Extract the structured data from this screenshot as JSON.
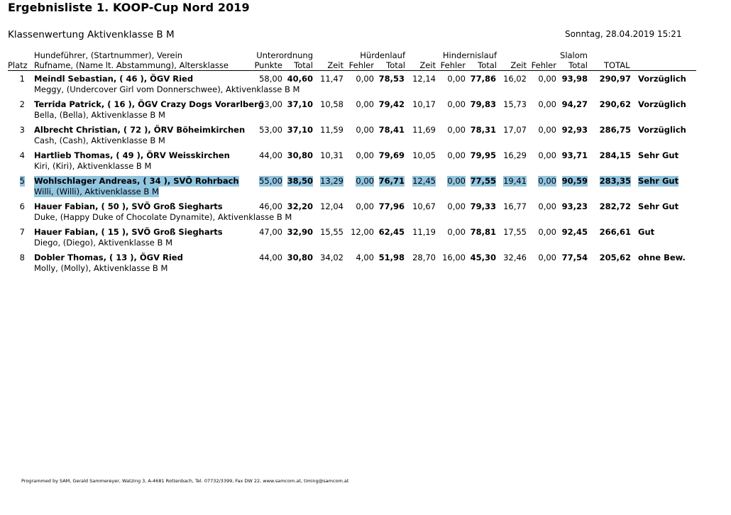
{
  "title": "Ergebnisliste 1. KOOP-Cup Nord 2019",
  "subtitle": "Klassenwertung Aktivenklasse B M",
  "datetime": "Sonntag, 28.04.2019 15:21",
  "headers": {
    "col_info_1": "Hundeführer, (Startnummer), Verein",
    "col_info_2": "Rufname, (Name lt. Abstammung), Altersklasse",
    "platz": "Platz",
    "unterordnung": "Unterordnung",
    "huerdenlauf": "Hürdenlauf",
    "hindernislauf": "Hindernislauf",
    "slalom": "Slalom",
    "punkte": "Punkte",
    "total": "Total",
    "zeit": "Zeit",
    "fehler": "Fehler",
    "grand_total": "TOTAL"
  },
  "rows": [
    {
      "platz": "1",
      "handler": "Meindl Sebastian, ( 46 ), ÖGV Ried",
      "dog": "Meggy, (Undercover Girl vom Donnerschwee), Aktivenklasse B M",
      "uo_punkte": "58,00",
      "uo_total": "40,60",
      "h_zeit": "11,47",
      "h_fehler": "0,00",
      "h_total": "78,53",
      "hi_zeit": "12,14",
      "hi_fehler": "0,00",
      "hi_total": "77,86",
      "s_zeit": "16,02",
      "s_fehler": "0,00",
      "s_total": "93,98",
      "total": "290,97",
      "grade": "Vorzüglich"
    },
    {
      "platz": "2",
      "handler": "Terrida Patrick, ( 16 ), ÖGV Crazy Dogs Vorarlberg",
      "dog": "Bella, (Bella), Aktivenklasse B M",
      "uo_punkte": "53,00",
      "uo_total": "37,10",
      "h_zeit": "10,58",
      "h_fehler": "0,00",
      "h_total": "79,42",
      "hi_zeit": "10,17",
      "hi_fehler": "0,00",
      "hi_total": "79,83",
      "s_zeit": "15,73",
      "s_fehler": "0,00",
      "s_total": "94,27",
      "total": "290,62",
      "grade": "Vorzüglich"
    },
    {
      "platz": "3",
      "handler": "Albrecht Christian, ( 72 ), ÖRV Böheimkirchen",
      "dog": "Cash, (Cash), Aktivenklasse B M",
      "uo_punkte": "53,00",
      "uo_total": "37,10",
      "h_zeit": "11,59",
      "h_fehler": "0,00",
      "h_total": "78,41",
      "hi_zeit": "11,69",
      "hi_fehler": "0,00",
      "hi_total": "78,31",
      "s_zeit": "17,07",
      "s_fehler": "0,00",
      "s_total": "92,93",
      "total": "286,75",
      "grade": "Vorzüglich"
    },
    {
      "platz": "4",
      "handler": "Hartlieb Thomas, ( 49 ), ÖRV Weisskirchen",
      "dog": "Kiri, (Kiri), Aktivenklasse B M",
      "uo_punkte": "44,00",
      "uo_total": "30,80",
      "h_zeit": "10,31",
      "h_fehler": "0,00",
      "h_total": "79,69",
      "hi_zeit": "10,05",
      "hi_fehler": "0,00",
      "hi_total": "79,95",
      "s_zeit": "16,29",
      "s_fehler": "0,00",
      "s_total": "93,71",
      "total": "284,15",
      "grade": "Sehr Gut"
    },
    {
      "platz": "5",
      "handler": "Wohlschlager Andreas, ( 34 ), SVÖ Rohrbach",
      "dog": "Willi, (Willi), Aktivenklasse B M",
      "uo_punkte": "55,00",
      "uo_total": "38,50",
      "h_zeit": "13,29",
      "h_fehler": "0,00",
      "h_total": "76,71",
      "hi_zeit": "12,45",
      "hi_fehler": "0,00",
      "hi_total": "77,55",
      "s_zeit": "19,41",
      "s_fehler": "0,00",
      "s_total": "90,59",
      "total": "283,35",
      "grade": "Sehr Gut",
      "highlight": true
    },
    {
      "platz": "6",
      "handler": "Hauer Fabian, ( 50 ), SVÖ Groß Siegharts",
      "dog": "Duke, (Happy Duke of Chocolate Dynamite), Aktivenklasse B M",
      "uo_punkte": "46,00",
      "uo_total": "32,20",
      "h_zeit": "12,04",
      "h_fehler": "0,00",
      "h_total": "77,96",
      "hi_zeit": "10,67",
      "hi_fehler": "0,00",
      "hi_total": "79,33",
      "s_zeit": "16,77",
      "s_fehler": "0,00",
      "s_total": "93,23",
      "total": "282,72",
      "grade": "Sehr Gut"
    },
    {
      "platz": "7",
      "handler": "Hauer Fabian, ( 15 ), SVÖ Groß Siegharts",
      "dog": "Diego, (Diego), Aktivenklasse B M",
      "uo_punkte": "47,00",
      "uo_total": "32,90",
      "h_zeit": "15,55",
      "h_fehler": "12,00",
      "h_total": "62,45",
      "hi_zeit": "11,19",
      "hi_fehler": "0,00",
      "hi_total": "78,81",
      "s_zeit": "17,55",
      "s_fehler": "0,00",
      "s_total": "92,45",
      "total": "266,61",
      "grade": "Gut"
    },
    {
      "platz": "8",
      "handler": "Dobler Thomas, ( 13 ), ÖGV Ried",
      "dog": "Molly, (Molly), Aktivenklasse B M",
      "uo_punkte": "44,00",
      "uo_total": "30,80",
      "h_zeit": "34,02",
      "h_fehler": "4,00",
      "h_total": "51,98",
      "hi_zeit": "28,70",
      "hi_fehler": "16,00",
      "hi_total": "45,30",
      "s_zeit": "32,46",
      "s_fehler": "0,00",
      "s_total": "77,54",
      "total": "205,62",
      "grade": "ohne Bew."
    }
  ],
  "footer": "Programmed by SAM, Gerald Sammereyer, Watzing 3, A-4681 Rottenbach, Tel. 07732/3399, Fax DW 22, www.samcom.at, timing@samcom.at"
}
